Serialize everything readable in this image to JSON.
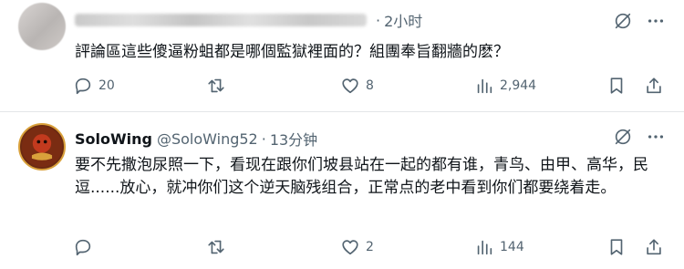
{
  "tweets": [
    {
      "author": {
        "display_name": "",
        "handle": "",
        "blurred": true
      },
      "time": "2小时",
      "text": "評論區這些傻逼粉蛆都是哪個監獄裡面的？組團奉旨翻牆的麽？",
      "stats": {
        "replies": "20",
        "retweets": "",
        "likes": "8",
        "views": "2,944"
      }
    },
    {
      "author": {
        "display_name": "SoloWing",
        "handle": "@SoloWing52",
        "blurred": false
      },
      "time": "13分钟",
      "text": "要不先撒泡尿照一下，看现在跟你们坡县站在一起的都有谁，青鸟、由甲、高华，民逗......放心，就冲你们这个逆天脑残组合，正常点的老中看到你们都要绕着走。",
      "stats": {
        "replies": "",
        "retweets": "",
        "likes": "2",
        "views": "144"
      }
    }
  ],
  "separator": "·",
  "icons": [
    "grok-icon",
    "more-icon",
    "reply-icon",
    "retweet-icon",
    "like-icon",
    "views-icon",
    "bookmark-icon",
    "share-icon"
  ],
  "colors": {
    "text": "#0f1419",
    "secondary": "#536471",
    "divider": "#e3e6e8",
    "avatar_bg": "#6b2a12"
  }
}
